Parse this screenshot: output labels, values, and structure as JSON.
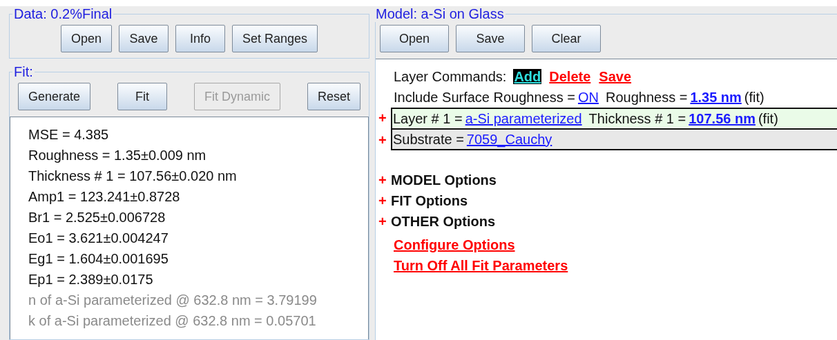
{
  "data_panel": {
    "title": "Data: 0.2%Final",
    "buttons": [
      {
        "label": "Open",
        "disabled": false
      },
      {
        "label": "Save",
        "disabled": false
      },
      {
        "label": "Info",
        "disabled": false
      },
      {
        "label": "Set Ranges",
        "disabled": false
      }
    ]
  },
  "fit_panel": {
    "title": "Fit:",
    "buttons": [
      {
        "label": "Generate",
        "disabled": false
      },
      {
        "label": "Fit",
        "disabled": false
      },
      {
        "label": "Fit Dynamic",
        "disabled": true
      },
      {
        "label": "Reset",
        "disabled": false
      }
    ],
    "results": [
      {
        "text": "MSE = 4.385",
        "kind": "fit"
      },
      {
        "text": "Roughness = 1.35±0.009 nm",
        "kind": "fit"
      },
      {
        "text": "Thickness # 1 = 107.56±0.020 nm",
        "kind": "fit"
      },
      {
        "text": "Amp1 = 123.241±0.8728",
        "kind": "fit"
      },
      {
        "text": "Br1 = 2.525±0.006728",
        "kind": "fit"
      },
      {
        "text": "Eo1 = 3.621±0.004247",
        "kind": "fit"
      },
      {
        "text": "Eg1 = 1.604±0.001695",
        "kind": "fit"
      },
      {
        "text": "Ep1 = 2.389±0.0175",
        "kind": "fit"
      },
      {
        "text": "n of a-Si parameterized @ 632.8 nm = 3.79199",
        "kind": "derived"
      },
      {
        "text": "k of a-Si parameterized @ 632.8 nm = 0.05701",
        "kind": "derived"
      }
    ]
  },
  "model_panel": {
    "title": "Model: a-Si on Glass",
    "buttons": [
      {
        "label": "Open",
        "disabled": false
      },
      {
        "label": "Save",
        "disabled": false
      },
      {
        "label": "Clear",
        "disabled": false
      }
    ],
    "layer_commands": {
      "label": "Layer Commands:",
      "actions": [
        {
          "label": "Add",
          "selected": true
        },
        {
          "label": "Delete",
          "selected": false
        },
        {
          "label": "Save",
          "selected": false
        }
      ]
    },
    "roughness": {
      "label": "Include Surface Roughness =",
      "state": "ON",
      "value_label": "Roughness =",
      "value": "1.35 nm",
      "note": "(fit)"
    },
    "layers": [
      {
        "kind": "layer",
        "expand": "+",
        "label": "Layer # 1 =",
        "material": "a-Si parameterized",
        "thickness_label": "Thickness # 1 =",
        "thickness": "107.56 nm",
        "note": "(fit)"
      },
      {
        "kind": "substrate",
        "expand": "+",
        "label": "Substrate =",
        "material": "7059_Cauchy"
      }
    ],
    "option_groups": [
      {
        "expand": "+",
        "label": "MODEL Options"
      },
      {
        "expand": "+",
        "label": "FIT Options"
      },
      {
        "expand": "+",
        "label": "OTHER Options"
      }
    ],
    "links": [
      "Configure Options",
      "Turn Off All Fit Parameters"
    ]
  }
}
